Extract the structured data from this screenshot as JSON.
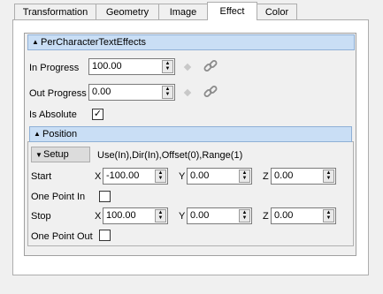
{
  "tabs": [
    {
      "label": "Transformation",
      "active": false
    },
    {
      "label": "Geometry",
      "active": false
    },
    {
      "label": "Image",
      "active": false
    },
    {
      "label": "Effect",
      "active": true
    },
    {
      "label": "Color",
      "active": false
    }
  ],
  "effect": {
    "header": "PerCharacterTextEffects",
    "in_progress": {
      "label": "In Progress",
      "value": "100.00"
    },
    "out_progress": {
      "label": "Out Progress",
      "value": "0.00"
    },
    "is_absolute": {
      "label": "Is Absolute",
      "checked": true
    },
    "position": {
      "header": "Position",
      "setup_label": "Setup",
      "setup_summary": "Use(In),Dir(In),Offset(0),Range(1)",
      "start": {
        "label": "Start",
        "x_label": "X",
        "x": "-100.00",
        "y_label": "Y",
        "y": "0.00",
        "z_label": "Z",
        "z": "0.00"
      },
      "one_point_in": {
        "label": "One Point In",
        "checked": false
      },
      "stop": {
        "label": "Stop",
        "x_label": "X",
        "x": "100.00",
        "y_label": "Y",
        "y": "0.00",
        "z_label": "Z",
        "z": "0.00"
      },
      "one_point_out": {
        "label": "One Point Out",
        "checked": false
      }
    }
  },
  "colors": {
    "header_bg": "#c9def5",
    "header_border": "#8fb0d6",
    "panel_bg": "#f0f0f0"
  },
  "icons": {
    "keyframe": "diamond-icon",
    "link": "chain-link-icon",
    "collapse": "triangle-up-icon",
    "dropdown": "triangle-down-icon"
  }
}
